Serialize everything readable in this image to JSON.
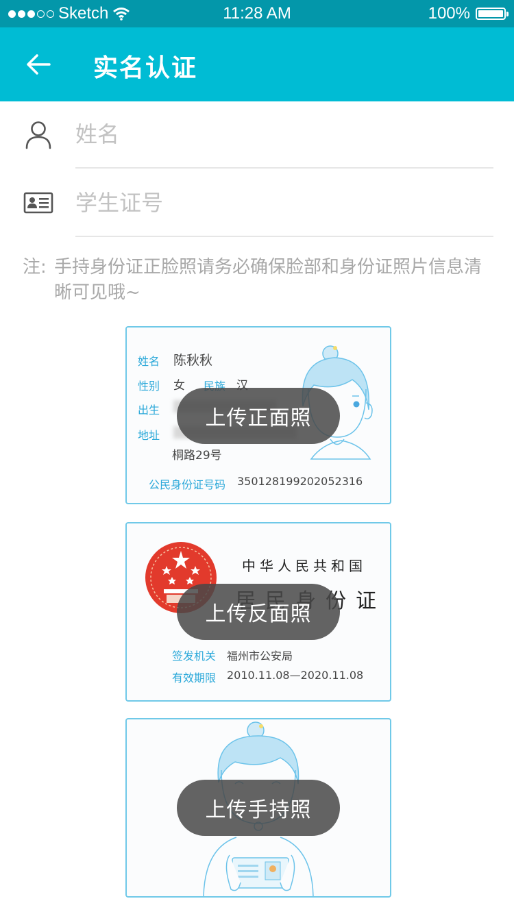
{
  "status_bar": {
    "carrier": "Sketch",
    "time": "11:28 AM",
    "battery": "100%"
  },
  "header": {
    "title": "实名认证",
    "back_icon": "arrow-left-icon"
  },
  "form": {
    "name_placeholder": "姓名",
    "student_id_placeholder": "学生证号",
    "name_icon": "person-icon",
    "id_icon": "id-card-icon"
  },
  "note": {
    "label": "注:",
    "text": "手持身份证正脸照请务必确保脸部和身份证照片信息清晰可见哦~"
  },
  "front_card": {
    "name_label": "姓名",
    "name_value": "陈秋秋",
    "gender_label": "性别",
    "gender_value": "女",
    "ethnicity_label": "民族",
    "ethnicity_value": "汉",
    "birth_label": "出生",
    "address_label": "地址",
    "address_line2": "桐路29号",
    "id_label": "公民身份证号码",
    "id_value": "350128199202052316",
    "upload_label": "上传正面照"
  },
  "back_card": {
    "country": "中华人民共和国",
    "doc_title": "居民身份证",
    "authority_label": "签发机关",
    "authority_value": "福州市公安局",
    "validity_label": "有效期限",
    "validity_value": "2010.11.08—2020.11.08",
    "upload_label": "上传反面照"
  },
  "hand_card": {
    "upload_label": "上传手持照"
  },
  "colors": {
    "status_bar": "#0397aa",
    "header": "#00bcd4",
    "card_border": "#70c9e8",
    "card_label": "#2aa8d9"
  }
}
